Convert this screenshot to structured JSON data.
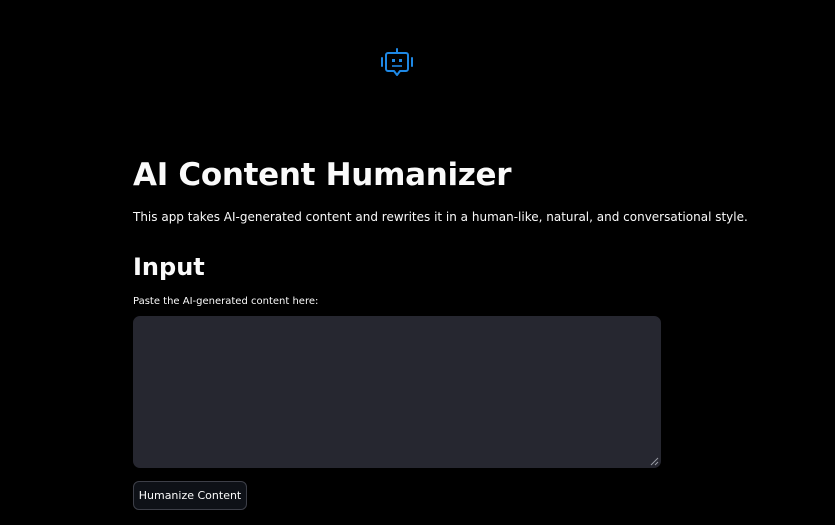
{
  "header": {
    "logo_icon": "robot-icon",
    "logo_color": "#1e88e5"
  },
  "main": {
    "title": "AI Content Humanizer",
    "description": "This app takes AI-generated content and rewrites it in a human-like, natural, and conversational style.",
    "section_heading": "Input",
    "input_label": "Paste the AI-generated content here:",
    "input_value": "",
    "button_label": "Humanize Content"
  },
  "colors": {
    "background": "#000000",
    "text": "#fafafa",
    "input_background": "#262730",
    "accent": "#1e88e5"
  }
}
